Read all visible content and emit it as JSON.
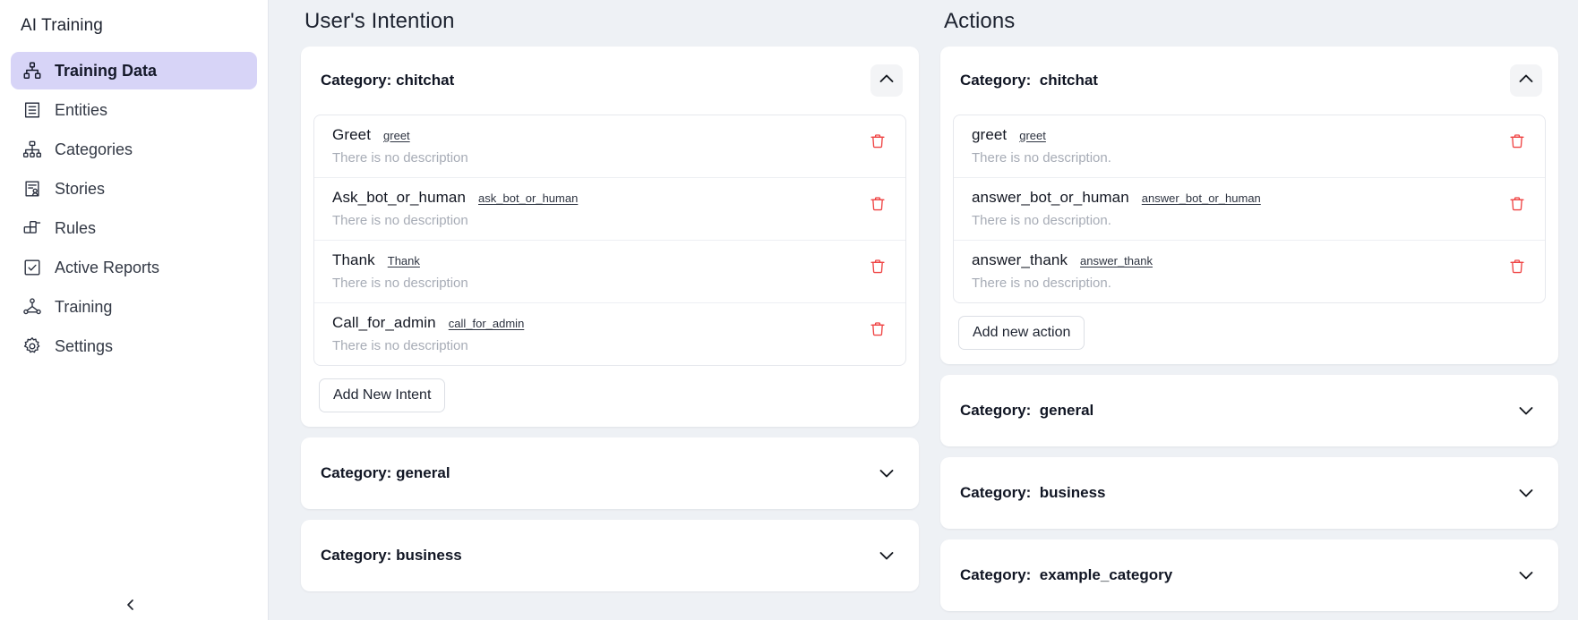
{
  "sidebar": {
    "brand": "AI Training",
    "items": [
      {
        "label": "Training Data",
        "icon": "org-chart-icon",
        "active": true
      },
      {
        "label": "Entities",
        "icon": "list-box-icon",
        "active": false
      },
      {
        "label": "Categories",
        "icon": "hierarchy-icon",
        "active": false
      },
      {
        "label": "Stories",
        "icon": "story-doc-icon",
        "active": false
      },
      {
        "label": "Rules",
        "icon": "grid-blocks-icon",
        "active": false
      },
      {
        "label": "Active Reports",
        "icon": "checkbox-icon",
        "active": false
      },
      {
        "label": "Training",
        "icon": "network-icon",
        "active": false
      },
      {
        "label": "Settings",
        "icon": "gear-icon",
        "active": false
      }
    ],
    "collapse_icon": "chevron-left-icon"
  },
  "colors": {
    "accent": "#d7d4f7",
    "danger": "#ef4444",
    "page_bg": "#eef1f5",
    "card_bg": "#ffffff",
    "muted_text": "#a7acb6"
  },
  "intention": {
    "title": "User's Intention",
    "add_button": "Add New Intent",
    "categories": [
      {
        "title": "Category: chitchat",
        "expanded": true,
        "chevron": "chevron-up-icon",
        "items": [
          {
            "name": "Greet",
            "code": "greet",
            "desc": "There is no description"
          },
          {
            "name": "Ask_bot_or_human",
            "code": "ask_bot_or_human",
            "desc": "There is no description"
          },
          {
            "name": "Thank",
            "code": "Thank",
            "desc": "There is no description"
          },
          {
            "name": "Call_for_admin",
            "code": "call_for_admin",
            "desc": "There is no description"
          }
        ]
      },
      {
        "title": "Category: general",
        "expanded": false,
        "chevron": "chevron-down-icon",
        "items": []
      },
      {
        "title": "Category: business",
        "expanded": false,
        "chevron": "chevron-down-icon",
        "items": []
      }
    ]
  },
  "actions": {
    "title": "Actions",
    "add_button": "Add new action",
    "categories": [
      {
        "title": "Category:  chitchat",
        "expanded": true,
        "chevron": "chevron-up-icon",
        "items": [
          {
            "name": "greet",
            "code": "greet",
            "desc": "There is no description."
          },
          {
            "name": "answer_bot_or_human",
            "code": "answer_bot_or_human",
            "desc": "There is no description."
          },
          {
            "name": "answer_thank",
            "code": "answer_thank",
            "desc": "There is no description."
          }
        ]
      },
      {
        "title": "Category:  general",
        "expanded": false,
        "chevron": "chevron-down-icon",
        "items": []
      },
      {
        "title": "Category:  business",
        "expanded": false,
        "chevron": "chevron-down-icon",
        "items": []
      },
      {
        "title": "Category:  example_category",
        "expanded": false,
        "chevron": "chevron-down-icon",
        "items": []
      }
    ]
  }
}
